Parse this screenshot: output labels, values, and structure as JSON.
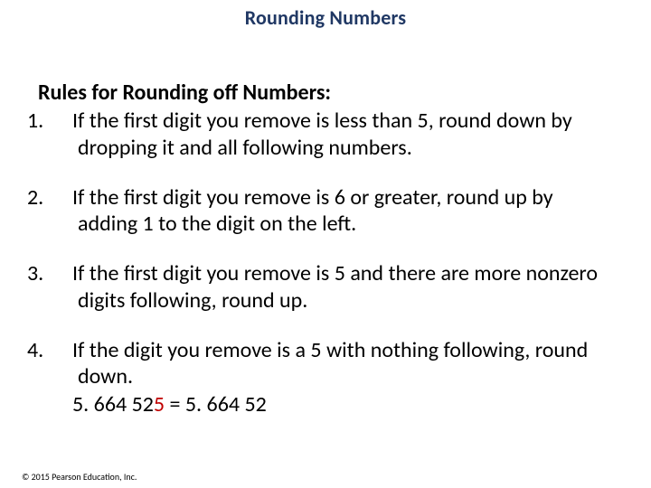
{
  "title": "Rounding Numbers",
  "subhead": "Rules for Rounding off Numbers:",
  "rules": {
    "r1": {
      "num": "1.",
      "text": "If the first digit you remove is less than 5, round down by dropping it and all following numbers."
    },
    "r2": {
      "num": "2.",
      "text": "If the first digit you remove is 6 or greater, round up by adding 1 to the digit on the left."
    },
    "r3": {
      "num": "3.",
      "text": "If the first digit you remove is 5 and there are more nonzero digits following, round up."
    },
    "r4": {
      "num": "4.",
      "text": "If the digit you remove is a 5 with nothing following, round down."
    }
  },
  "example": {
    "lhs_a": "5. 664 52",
    "lhs_b": "5",
    "eq": " = ",
    "rhs": "5. 664 52"
  },
  "copyright": "© 2015 Pearson Education, Inc."
}
